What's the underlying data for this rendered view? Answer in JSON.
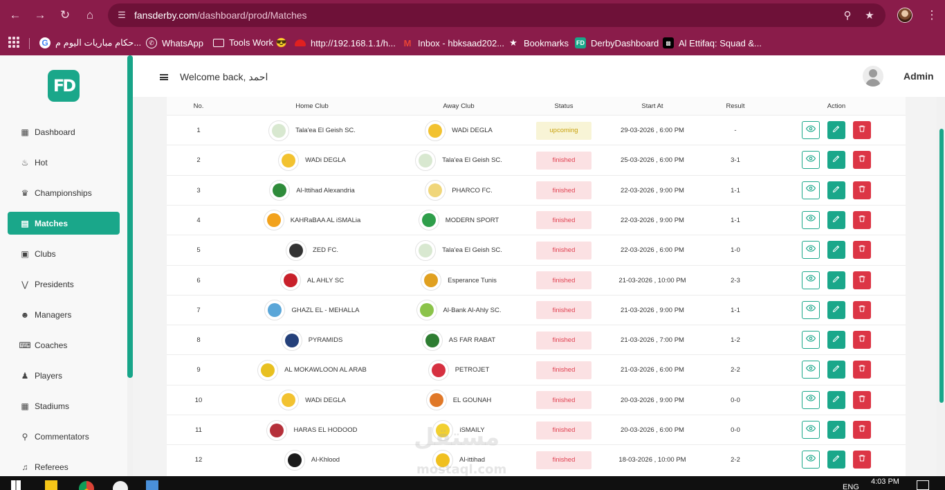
{
  "browser": {
    "url_domain": "fansderby.com",
    "url_path": "/dashboard/prod/Matches",
    "bookmarks": [
      {
        "label": "حكام مباريات اليوم م..."
      },
      {
        "label": "WhatsApp"
      },
      {
        "label": "Tools Work 😎"
      },
      {
        "label": "http://192.168.1.1/h..."
      },
      {
        "label": "Inbox - hbksaad202..."
      },
      {
        "label": "Bookmarks"
      },
      {
        "label": "DerbyDashboard"
      },
      {
        "label": "Al Ettifaq: Squad &..."
      }
    ]
  },
  "app": {
    "logo_text": "FD",
    "welcome": "Welcome back, احمد",
    "admin_name": "Admin",
    "accent_color": "#1aa78a"
  },
  "sidebar": {
    "items": [
      {
        "label": "Dashboard",
        "icon": "grid-icon"
      },
      {
        "label": "Hot",
        "icon": "flame-icon"
      },
      {
        "label": "Championships",
        "icon": "trophy-icon"
      },
      {
        "label": "Matches",
        "icon": "pitch-icon",
        "active": true
      },
      {
        "label": "Clubs",
        "icon": "clubs-icon"
      },
      {
        "label": "Presidents",
        "icon": "tie-icon"
      },
      {
        "label": "Managers",
        "icon": "manager-icon"
      },
      {
        "label": "Coaches",
        "icon": "clipboard-icon"
      },
      {
        "label": "Players",
        "icon": "players-icon"
      },
      {
        "label": "Stadiums",
        "icon": "stadium-icon"
      },
      {
        "label": "Commentators",
        "icon": "microphone-icon"
      },
      {
        "label": "Referees",
        "icon": "whistle-icon"
      }
    ]
  },
  "table": {
    "headers": {
      "no": "No.",
      "home": "Home Club",
      "away": "Away Club",
      "status": "Status",
      "start": "Start At",
      "result": "Result",
      "action": "Action"
    },
    "rows": [
      {
        "no": "1",
        "home": "Tala'ea El Geish SC.",
        "home_color": "#d8e8d0",
        "away": "WADi DEGLA",
        "away_color": "#f2c230",
        "status": "upcoming",
        "start": "29-03-2026 , 6:00 PM",
        "result": "-"
      },
      {
        "no": "2",
        "home": "WADi DEGLA",
        "home_color": "#f2c230",
        "away": "Tala'ea El Geish SC.",
        "away_color": "#d8e8d0",
        "status": "finished",
        "start": "25-03-2026 , 6:00 PM",
        "result": "3-1"
      },
      {
        "no": "3",
        "home": "Al-Ittihad Alexandria",
        "home_color": "#2e8b3a",
        "away": "PHARCO FC.",
        "away_color": "#f0d67a",
        "status": "finished",
        "start": "22-03-2026 , 9:00 PM",
        "result": "1-1"
      },
      {
        "no": "4",
        "home": "KAHRaBAA AL iSMALia",
        "home_color": "#f2a21c",
        "away": "MODERN SPORT",
        "away_color": "#2e9e4a",
        "status": "finished",
        "start": "22-03-2026 , 9:00 PM",
        "result": "1-1"
      },
      {
        "no": "5",
        "home": "ZED FC.",
        "home_color": "#333333",
        "away": "Tala'ea El Geish SC.",
        "away_color": "#d8e8d0",
        "status": "finished",
        "start": "22-03-2026 , 6:00 PM",
        "result": "1-0"
      },
      {
        "no": "6",
        "home": "AL AHLY SC",
        "home_color": "#c8202a",
        "away": "Esperance Tunis",
        "away_color": "#e0a020",
        "status": "finished",
        "start": "21-03-2026 , 10:00 PM",
        "result": "2-3"
      },
      {
        "no": "7",
        "home": "GHAZL EL - MEHALLA",
        "home_color": "#5aa6d8",
        "away": "Al-Bank Al-Ahly SC.",
        "away_color": "#8bc34a",
        "status": "finished",
        "start": "21-03-2026 , 9:00 PM",
        "result": "1-1"
      },
      {
        "no": "8",
        "home": "PYRAMIDS",
        "home_color": "#24407a",
        "away": "AS FAR RABAT",
        "away_color": "#2e7d32",
        "status": "finished",
        "start": "21-03-2026 , 7:00 PM",
        "result": "1-2"
      },
      {
        "no": "9",
        "home": "AL MOKAWLOON AL ARAB",
        "home_color": "#e8c020",
        "away": "PETROJET",
        "away_color": "#d63040",
        "status": "finished",
        "start": "21-03-2026 , 6:00 PM",
        "result": "2-2"
      },
      {
        "no": "10",
        "home": "WADi DEGLA",
        "home_color": "#f2c230",
        "away": "EL GOUNAH",
        "away_color": "#e07828",
        "status": "finished",
        "start": "20-03-2026 , 9:00 PM",
        "result": "0-0"
      },
      {
        "no": "11",
        "home": "HARAS EL HODOOD",
        "home_color": "#b5303a",
        "away": "iSMAILY",
        "away_color": "#f2d030",
        "status": "finished",
        "start": "20-03-2026 , 6:00 PM",
        "result": "0-0"
      },
      {
        "no": "12",
        "home": "Al-Khlood",
        "home_color": "#1a1a1a",
        "away": "Al-ittihad",
        "away_color": "#f0c020",
        "status": "finished",
        "start": "18-03-2026 , 10:00 PM",
        "result": "2-2"
      }
    ]
  },
  "taskbar": {
    "lang": "ENG",
    "time": "4:03 PM"
  },
  "watermark": {
    "arabic": "مستقل",
    "latin": "mostaql.com"
  }
}
